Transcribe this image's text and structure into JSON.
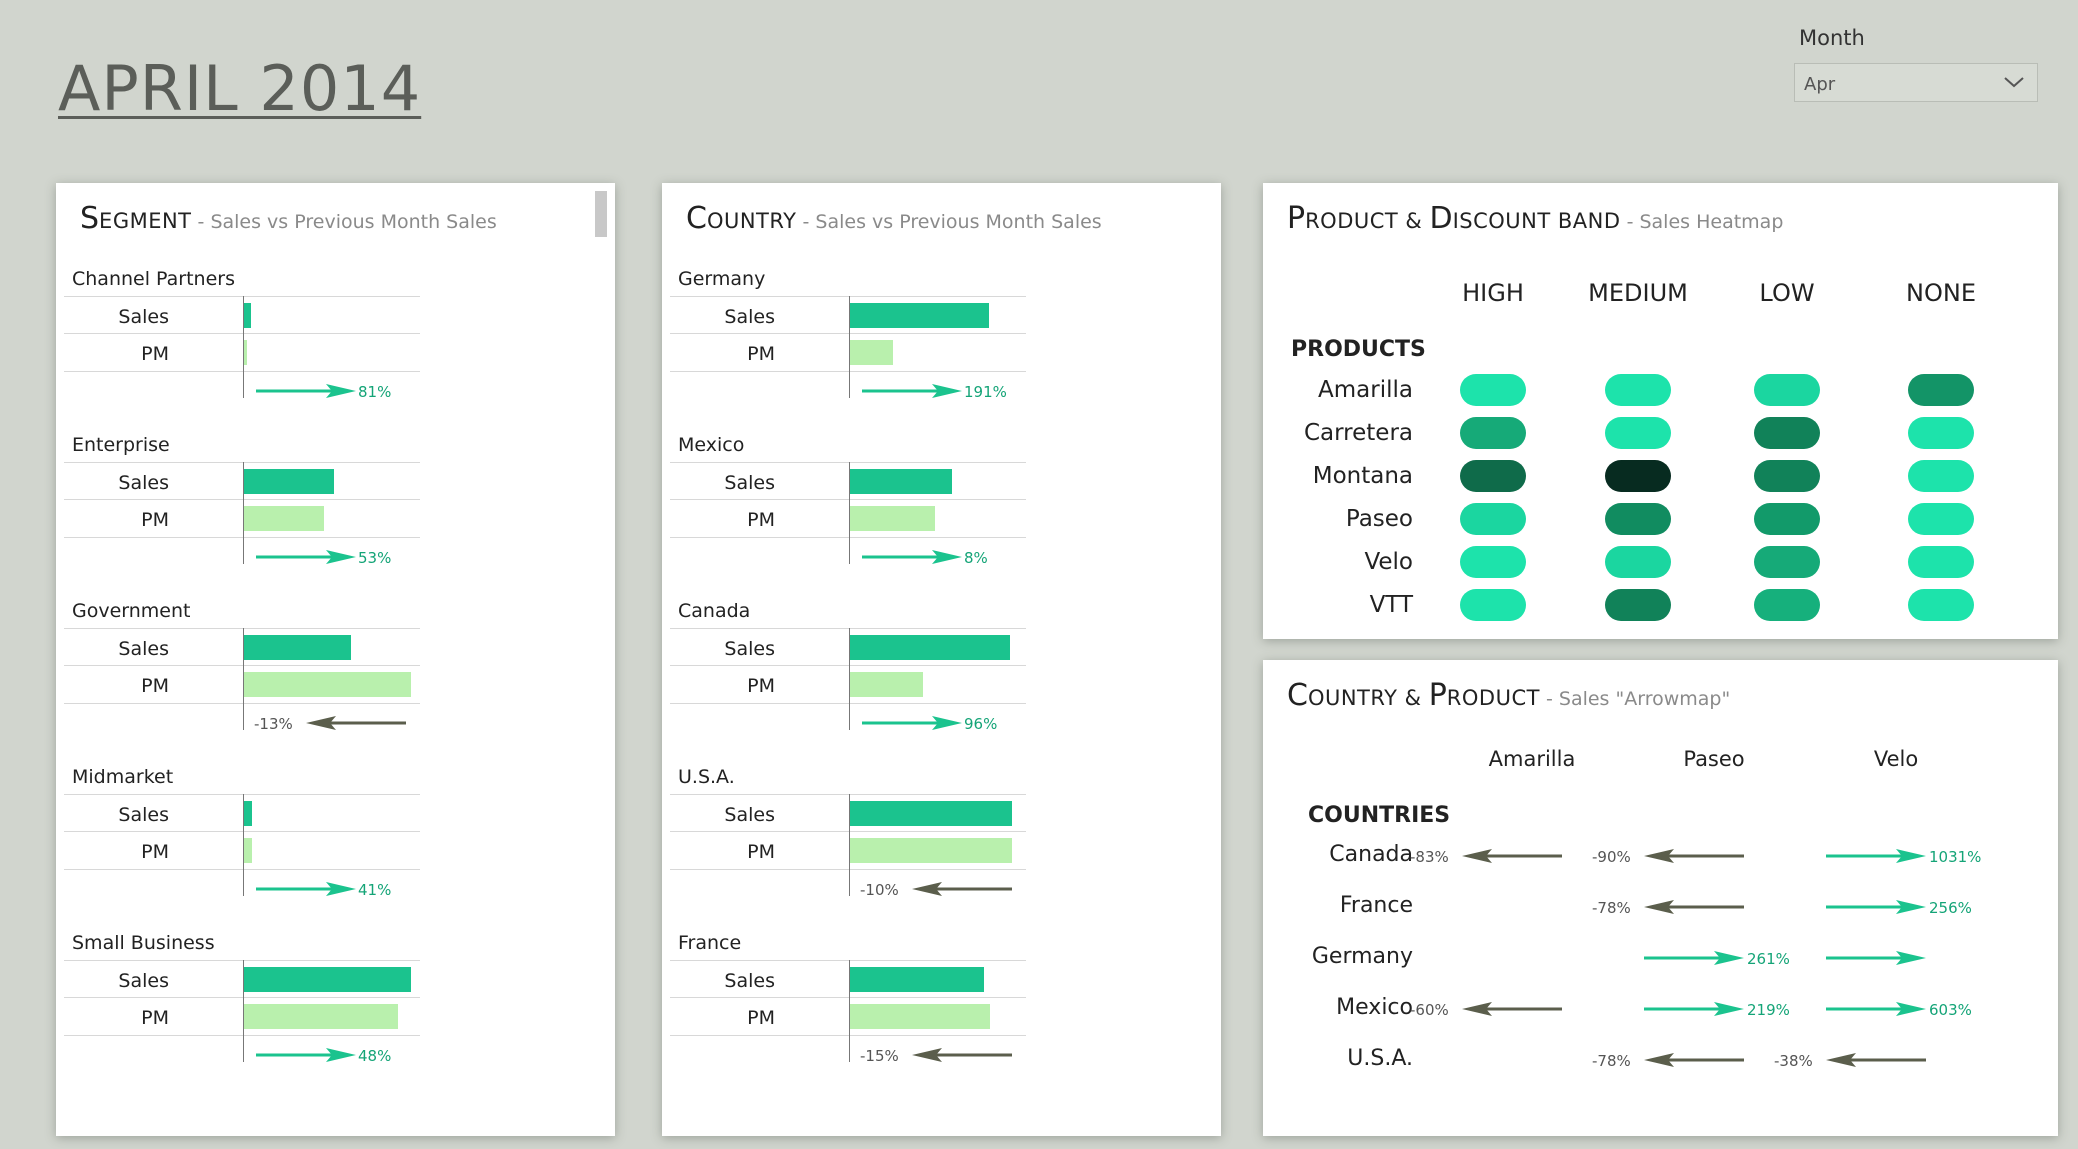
{
  "header": {
    "title": "APRIL 2014"
  },
  "filter": {
    "label": "Month",
    "value": "Apr",
    "icon": "chevron-down-icon"
  },
  "colors": {
    "up": "#1bc38e",
    "down": "#5b5e4c",
    "sales_bar": "#1bc38e",
    "pm_bar": "#b9f0ad"
  },
  "segment_panel": {
    "title_cap": "S",
    "title_rest": "egment",
    "subtitle": " - Sales vs Previous Month Sales",
    "row_labels": {
      "sales": "Sales",
      "pm": "PM"
    },
    "groups": [
      {
        "name": "Channel Partners",
        "sales": 0.04,
        "pm": 0.02,
        "change": "81%",
        "direction": "up"
      },
      {
        "name": "Enterprise",
        "sales": 0.54,
        "pm": 0.48,
        "change": "53%",
        "direction": "up"
      },
      {
        "name": "Government",
        "sales": 0.64,
        "pm": 1.0,
        "change": "-13%",
        "direction": "down"
      },
      {
        "name": "Midmarket",
        "sales": 0.05,
        "pm": 0.05,
        "change": "41%",
        "direction": "up"
      },
      {
        "name": "Small Business",
        "sales": 1.0,
        "pm": 0.92,
        "change": "48%",
        "direction": "up"
      }
    ]
  },
  "country_panel": {
    "title_cap": "C",
    "title_rest": "ountry",
    "subtitle": " - Sales vs Previous Month Sales",
    "row_labels": {
      "sales": "Sales",
      "pm": "PM"
    },
    "groups": [
      {
        "name": "Germany",
        "sales": 0.83,
        "pm": 0.26,
        "change": "191%",
        "direction": "up"
      },
      {
        "name": "Mexico",
        "sales": 0.61,
        "pm": 0.51,
        "change": "8%",
        "direction": "up"
      },
      {
        "name": "Canada",
        "sales": 0.96,
        "pm": 0.44,
        "change": "96%",
        "direction": "up"
      },
      {
        "name": "U.S.A.",
        "sales": 0.97,
        "pm": 0.97,
        "change": "-10%",
        "direction": "down"
      },
      {
        "name": "France",
        "sales": 0.8,
        "pm": 0.84,
        "change": "-15%",
        "direction": "down"
      }
    ]
  },
  "heatmap_panel": {
    "title_cap1": "P",
    "title_rest1": "roduct",
    "amp": " & ",
    "title_cap2": "D",
    "title_rest2": "iscount band",
    "subtitle": " - Sales Heatmap",
    "columns": [
      "HIGH",
      "MEDIUM",
      "LOW",
      "NONE"
    ],
    "section_label": "PRODUCTS",
    "rows": [
      {
        "name": "Amarilla",
        "colors": [
          "#1de3ab",
          "#1de3ab",
          "#1bd6a0",
          "#139467"
        ]
      },
      {
        "name": "Carretera",
        "colors": [
          "#16aa78",
          "#1de3ab",
          "#118259",
          "#1de3ab"
        ]
      },
      {
        "name": "Montana",
        "colors": [
          "#0f6b4a",
          "#072b20",
          "#118259",
          "#1de3ab"
        ]
      },
      {
        "name": "Paseo",
        "colors": [
          "#1bd6a0",
          "#118c60",
          "#129a6a",
          "#1de3ab"
        ]
      },
      {
        "name": "Velo",
        "colors": [
          "#1de3ab",
          "#1bd6a0",
          "#16aa78",
          "#1de3ab"
        ]
      },
      {
        "name": "VTT",
        "colors": [
          "#1de3ab",
          "#118259",
          "#16b07c",
          "#1de3ab"
        ]
      }
    ]
  },
  "arrowmap_panel": {
    "title_cap1": "C",
    "title_rest1": "ountry",
    "amp": " & ",
    "title_cap2": "P",
    "title_rest2": "roduct",
    "subtitle": " - Sales \"Arrowmap\"",
    "columns": [
      "Amarilla",
      "Paseo",
      "Velo"
    ],
    "section_label": "COUNTRIES",
    "rows": [
      {
        "name": "Canada",
        "cells": [
          {
            "dir": "down",
            "pct": "-83%"
          },
          {
            "dir": "down",
            "pct": "-90%"
          },
          {
            "dir": "up",
            "pct": "1031%"
          }
        ]
      },
      {
        "name": "France",
        "cells": [
          null,
          {
            "dir": "down",
            "pct": "-78%"
          },
          {
            "dir": "up",
            "pct": "256%"
          }
        ]
      },
      {
        "name": "Germany",
        "cells": [
          null,
          {
            "dir": "up",
            "pct": "261%"
          },
          {
            "dir": "up",
            "pct": ""
          }
        ]
      },
      {
        "name": "Mexico",
        "cells": [
          {
            "dir": "down",
            "pct": "-60%"
          },
          {
            "dir": "up",
            "pct": "219%"
          },
          {
            "dir": "up",
            "pct": "603%"
          }
        ]
      },
      {
        "name": "U.S.A.",
        "cells": [
          null,
          {
            "dir": "down",
            "pct": "-78%"
          },
          {
            "dir": "down",
            "pct": "-38%"
          }
        ]
      }
    ]
  }
}
